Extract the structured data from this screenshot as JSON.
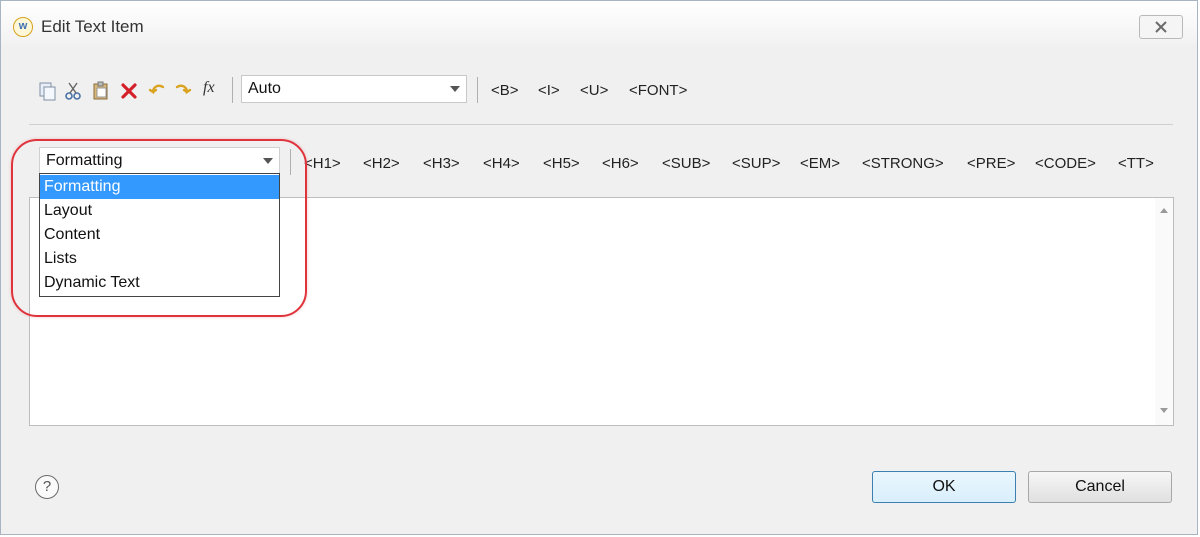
{
  "window": {
    "title": "Edit Text Item",
    "app_icon_letter": "w"
  },
  "toolbar": {
    "icons": [
      "copy-icon",
      "cut-icon",
      "paste-icon",
      "delete-icon",
      "undo-icon",
      "redo-icon",
      "function-icon"
    ],
    "function_glyph": "fx",
    "font_combo_value": "Auto",
    "style_tags": [
      "<B>",
      "<I>",
      "<U>",
      "<FONT>"
    ]
  },
  "tag_row": {
    "category_combo_value": "Formatting",
    "tags": [
      "<H1>",
      "<H2>",
      "<H3>",
      "<H4>",
      "<H5>",
      "<H6>",
      "<SUB>",
      "<SUP>",
      "<EM>",
      "<STRONG>",
      "<PRE>",
      "<CODE>",
      "<TT>"
    ]
  },
  "category_dropdown": {
    "items": [
      "Formatting",
      "Layout",
      "Content",
      "Lists",
      "Dynamic Text"
    ],
    "selected": "Formatting"
  },
  "editor": {
    "value": ""
  },
  "footer": {
    "help_glyph": "?",
    "ok_label": "OK",
    "cancel_label": "Cancel"
  },
  "colors": {
    "highlight_ring": "#e0343c",
    "selection": "#3399ff",
    "ok_border": "#3c7fb1"
  }
}
